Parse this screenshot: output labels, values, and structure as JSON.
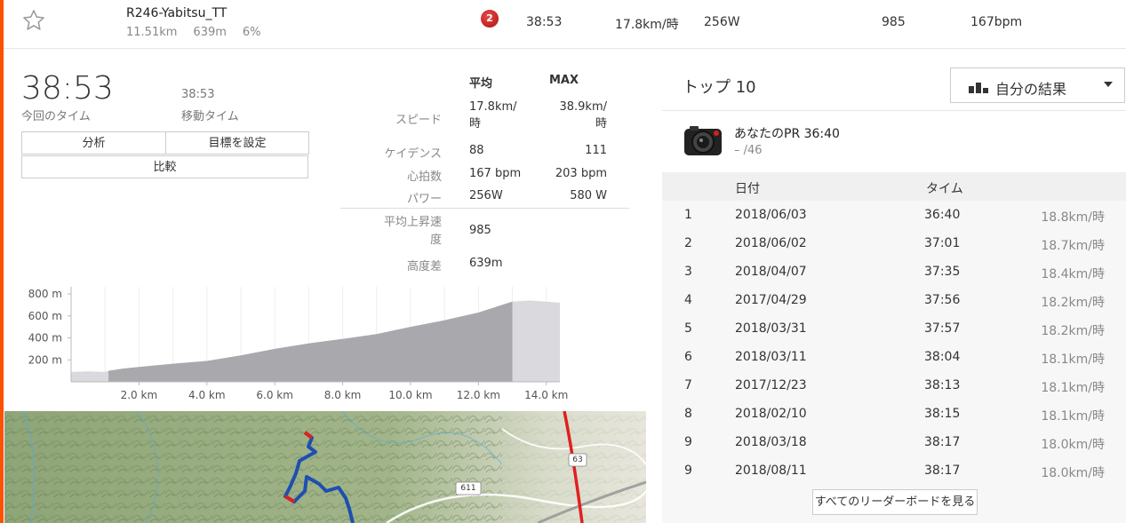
{
  "segment": {
    "name": "R246-Yabitsu_TT",
    "distance": "11.51km",
    "elevation": "639m",
    "grade": "6%",
    "rank": "2",
    "time": "38:53",
    "speed": "17.8km/時",
    "power": "256W",
    "vam": "985",
    "heartrate": "167bpm"
  },
  "effort": {
    "time": "38:53",
    "time_label": "今回のタイム",
    "moving_time": "38:53",
    "moving_label": "移動タイム",
    "btn_analyze": "分析",
    "btn_goal": "目標を設定",
    "btn_compare": "比較"
  },
  "stats": {
    "col_avg": "平均",
    "col_max": "MAX",
    "rows": [
      {
        "label": "スピード",
        "avg_line1": "17.8km/",
        "avg_line2": "時",
        "max_line1": "38.9km/",
        "max_line2": "時"
      },
      {
        "label": "ケイデンス",
        "avg": "88",
        "max": "111"
      },
      {
        "label": "心拍数",
        "avg": "167 bpm",
        "max": "203 bpm"
      },
      {
        "label": "パワー",
        "avg": "256W",
        "max": "580 W"
      }
    ],
    "vam_label_1": "平均上昇速",
    "vam_label_2": "度",
    "vam_value": "985",
    "gain_label": "高度差",
    "gain_value": "639m"
  },
  "chart_data": {
    "type": "area",
    "x_ticks": [
      "2.0 km",
      "4.0 km",
      "6.0 km",
      "8.0 km",
      "10.0 km",
      "12.0 km",
      "14.0 km"
    ],
    "y_ticks": [
      "200 m",
      "400 m",
      "600 m",
      "800 m"
    ],
    "xlim": [
      0,
      14.4
    ],
    "ylim": [
      0,
      800
    ],
    "segment_range_km": [
      1.1,
      13.0
    ],
    "x": [
      0,
      0.5,
      1.0,
      1.1,
      1.5,
      2.0,
      3.0,
      4.0,
      5.0,
      6.0,
      7.0,
      8.0,
      9.0,
      10.0,
      11.0,
      12.0,
      13.0,
      13.5,
      14.0,
      14.4
    ],
    "y": [
      90,
      95,
      90,
      100,
      120,
      135,
      165,
      190,
      240,
      300,
      350,
      390,
      435,
      500,
      560,
      630,
      730,
      740,
      730,
      720
    ]
  },
  "map": {
    "road_label_1": "611",
    "road_label_2": "63"
  },
  "top10": {
    "title": "トップ 10",
    "dropdown": "自分の結果",
    "pr_title": "あなたのPR 36:40",
    "pr_sub_dash": "–",
    "pr_sub_rank": "/46",
    "col_date": "日付",
    "col_time": "タイム",
    "rows": [
      {
        "rank": "1",
        "date": "2018/06/03",
        "time": "36:40",
        "speed": "18.8km/時"
      },
      {
        "rank": "2",
        "date": "2018/06/02",
        "time": "37:01",
        "speed": "18.7km/時"
      },
      {
        "rank": "3",
        "date": "2018/04/07",
        "time": "37:35",
        "speed": "18.4km/時"
      },
      {
        "rank": "4",
        "date": "2017/04/29",
        "time": "37:56",
        "speed": "18.2km/時"
      },
      {
        "rank": "5",
        "date": "2018/03/31",
        "time": "37:57",
        "speed": "18.2km/時"
      },
      {
        "rank": "6",
        "date": "2018/03/11",
        "time": "38:04",
        "speed": "18.1km/時"
      },
      {
        "rank": "7",
        "date": "2017/12/23",
        "time": "38:13",
        "speed": "18.1km/時"
      },
      {
        "rank": "8",
        "date": "2018/02/10",
        "time": "38:15",
        "speed": "18.1km/時"
      },
      {
        "rank": "9",
        "date": "2018/03/18",
        "time": "38:17",
        "speed": "18.0km/時"
      },
      {
        "rank": "9",
        "date": "2018/08/11",
        "time": "38:17",
        "speed": "18.0km/時"
      }
    ],
    "see_all": "すべてのリーダーボードを見る"
  },
  "colors": {
    "accent": "#fc5200",
    "medal": "#c0161a",
    "route": "#1e4fb0",
    "road": "#e02020"
  }
}
